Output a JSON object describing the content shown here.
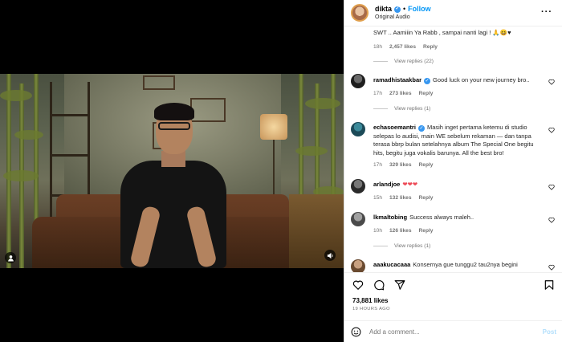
{
  "header": {
    "username": "dikta",
    "separator": "•",
    "follow_label": "Follow",
    "audio": "Original Audio"
  },
  "comments": [
    {
      "text": "SWT .. Aamiiin Ya Rabb , sampai nanti lagi ! 🙏😆♥",
      "time": "18h",
      "likes": "2,457 likes",
      "reply": "Reply",
      "view_replies": "View replies (22)"
    },
    {
      "user": "ramadhistaakbar",
      "verified": true,
      "text": "Good luck on your new journey bro..",
      "time": "17h",
      "likes": "273 likes",
      "reply": "Reply",
      "view_replies": "View replies (1)"
    },
    {
      "user": "echasoemantri",
      "verified": true,
      "text": "Masih inget pertama ketemu di studio selepas lo audisi, main WE sebelum rekaman — dan tanpa terasa bbrp bulan setelahnya album The Special One begitu hits, begitu juga vokalis barunya. All the best bro!",
      "time": "17h",
      "likes": "329 likes",
      "reply": "Reply"
    },
    {
      "user": "arlandjoe",
      "text": "❤❤❤",
      "time": "15h",
      "likes": "132 likes",
      "reply": "Reply"
    },
    {
      "user": "lkmaltobing",
      "text": "Success always maleh..",
      "time": "10h",
      "likes": "126 likes",
      "reply": "Reply",
      "view_replies": "View replies (1)"
    },
    {
      "user": "aaakucacaaa",
      "text": "Konsernya gue tunggu2 tau2nya begini"
    }
  ],
  "actions": {
    "likes": "73,881 likes",
    "time": "19 HOURS AGO"
  },
  "add_comment": {
    "placeholder": "Add a comment...",
    "post_label": "Post"
  },
  "colors": {
    "accent": "#0095f6",
    "verified": "#3797f0",
    "heart": "#ed4956",
    "muted": "#737373"
  },
  "icons": [
    "user-tag-icon",
    "mute-icon",
    "more-icon",
    "heart-icon",
    "comment-icon",
    "share-icon",
    "bookmark-icon",
    "emoji-icon",
    "verified-icon"
  ]
}
